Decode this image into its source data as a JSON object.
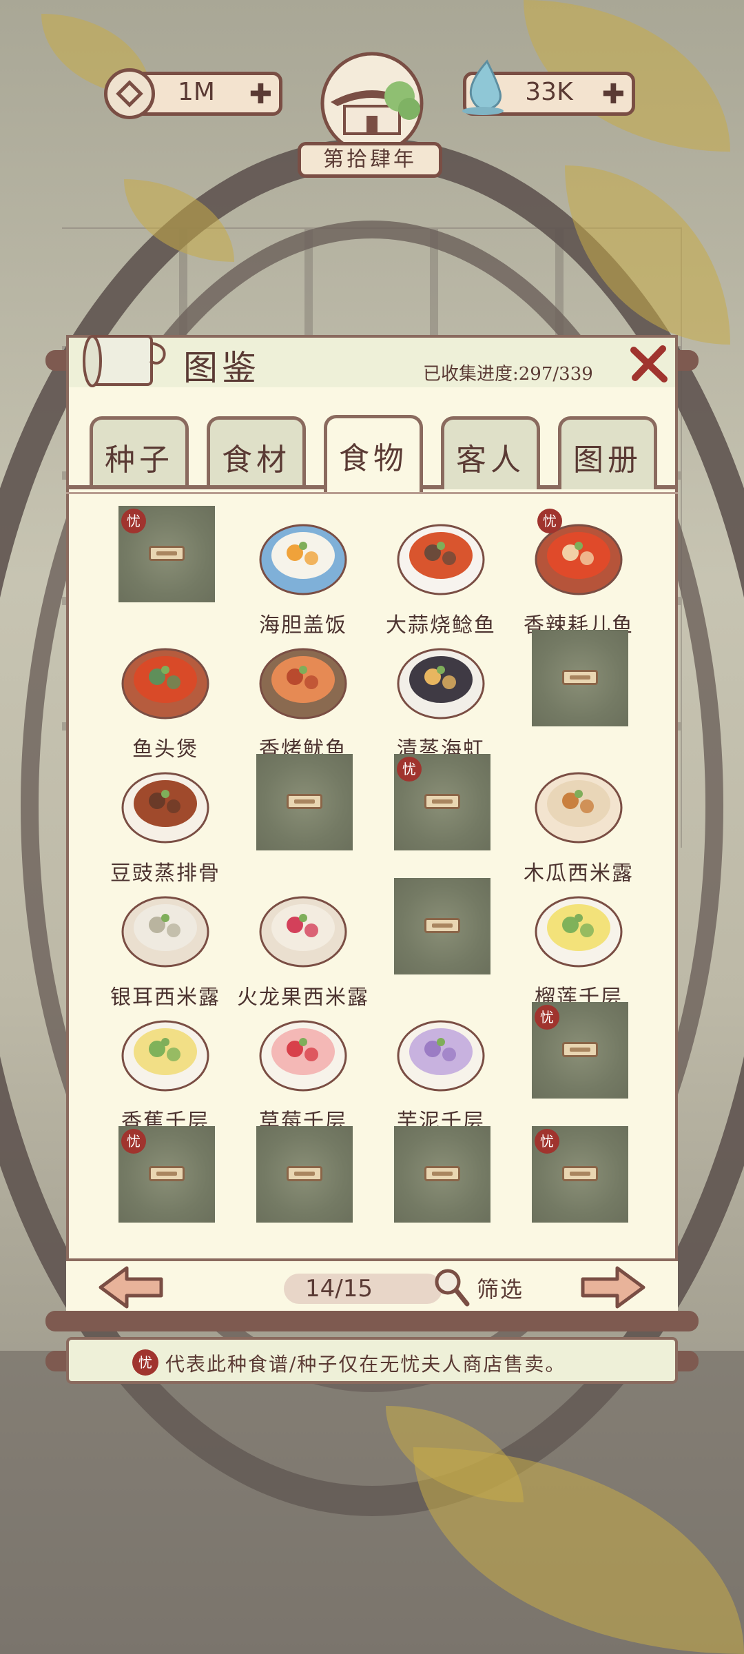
{
  "top_bar": {
    "coins": "1M",
    "water": "33K",
    "plus": "✚",
    "year": "第拾肆年"
  },
  "panel": {
    "title": "图鉴",
    "progress": "已收集进度:297/339"
  },
  "tabs": [
    {
      "label": "种子",
      "active": false
    },
    {
      "label": "食材",
      "active": false
    },
    {
      "label": "食物",
      "active": true
    },
    {
      "label": "客人",
      "active": false
    },
    {
      "label": "图册",
      "active": false
    }
  ],
  "badge_text": "忧",
  "grid": [
    {
      "label": "",
      "locked": true,
      "badge": true
    },
    {
      "label": "海胆盖饭",
      "locked": false,
      "badge": false,
      "icon": "sea-urchin-rice-bowl"
    },
    {
      "label": "大蒜烧鲶鱼",
      "locked": false,
      "badge": false,
      "icon": "garlic-catfish-plate"
    },
    {
      "label": "香辣耗儿鱼",
      "locked": false,
      "badge": true,
      "icon": "spicy-fish-pot"
    },
    {
      "label": "鱼头煲",
      "locked": false,
      "badge": false,
      "icon": "fish-head-pot"
    },
    {
      "label": "香烤鱿鱼",
      "locked": false,
      "badge": false,
      "icon": "grilled-squid-skewer"
    },
    {
      "label": "清蒸海虹",
      "locked": false,
      "badge": false,
      "icon": "steamed-mussels"
    },
    {
      "label": "",
      "locked": true,
      "badge": false
    },
    {
      "label": "豆豉蒸排骨",
      "locked": false,
      "badge": false,
      "icon": "steamed-ribs"
    },
    {
      "label": "",
      "locked": true,
      "badge": false
    },
    {
      "label": "",
      "locked": true,
      "badge": true
    },
    {
      "label": "木瓜西米露",
      "locked": false,
      "badge": false,
      "icon": "papaya-sago"
    },
    {
      "label": "银耳西米露",
      "locked": false,
      "badge": false,
      "icon": "white-fungus-sago"
    },
    {
      "label": "火龙果西米露",
      "locked": false,
      "badge": false,
      "icon": "dragonfruit-sago"
    },
    {
      "label": "",
      "locked": true,
      "badge": false
    },
    {
      "label": "榴莲千层",
      "locked": false,
      "badge": false,
      "icon": "durian-crepe-cake"
    },
    {
      "label": "香蕉千层",
      "locked": false,
      "badge": false,
      "icon": "banana-crepe-cake"
    },
    {
      "label": "草莓千层",
      "locked": false,
      "badge": false,
      "icon": "strawberry-crepe-cake"
    },
    {
      "label": "芋泥千层",
      "locked": false,
      "badge": false,
      "icon": "taro-crepe-cake"
    },
    {
      "label": "",
      "locked": true,
      "badge": true
    },
    {
      "label": "",
      "locked": true,
      "badge": true
    },
    {
      "label": "",
      "locked": true,
      "badge": false
    },
    {
      "label": "",
      "locked": true,
      "badge": false
    },
    {
      "label": "",
      "locked": true,
      "badge": true
    }
  ],
  "pager": {
    "page": "14/15",
    "filter": "筛选"
  },
  "footer": {
    "note": "代表此种食谱/种子仅在无忧夫人商店售卖。"
  },
  "colors": {
    "frame": "#8a6a5e",
    "paper": "#fbf8e3",
    "badge": "#a0342e",
    "text": "#5a3a34"
  }
}
